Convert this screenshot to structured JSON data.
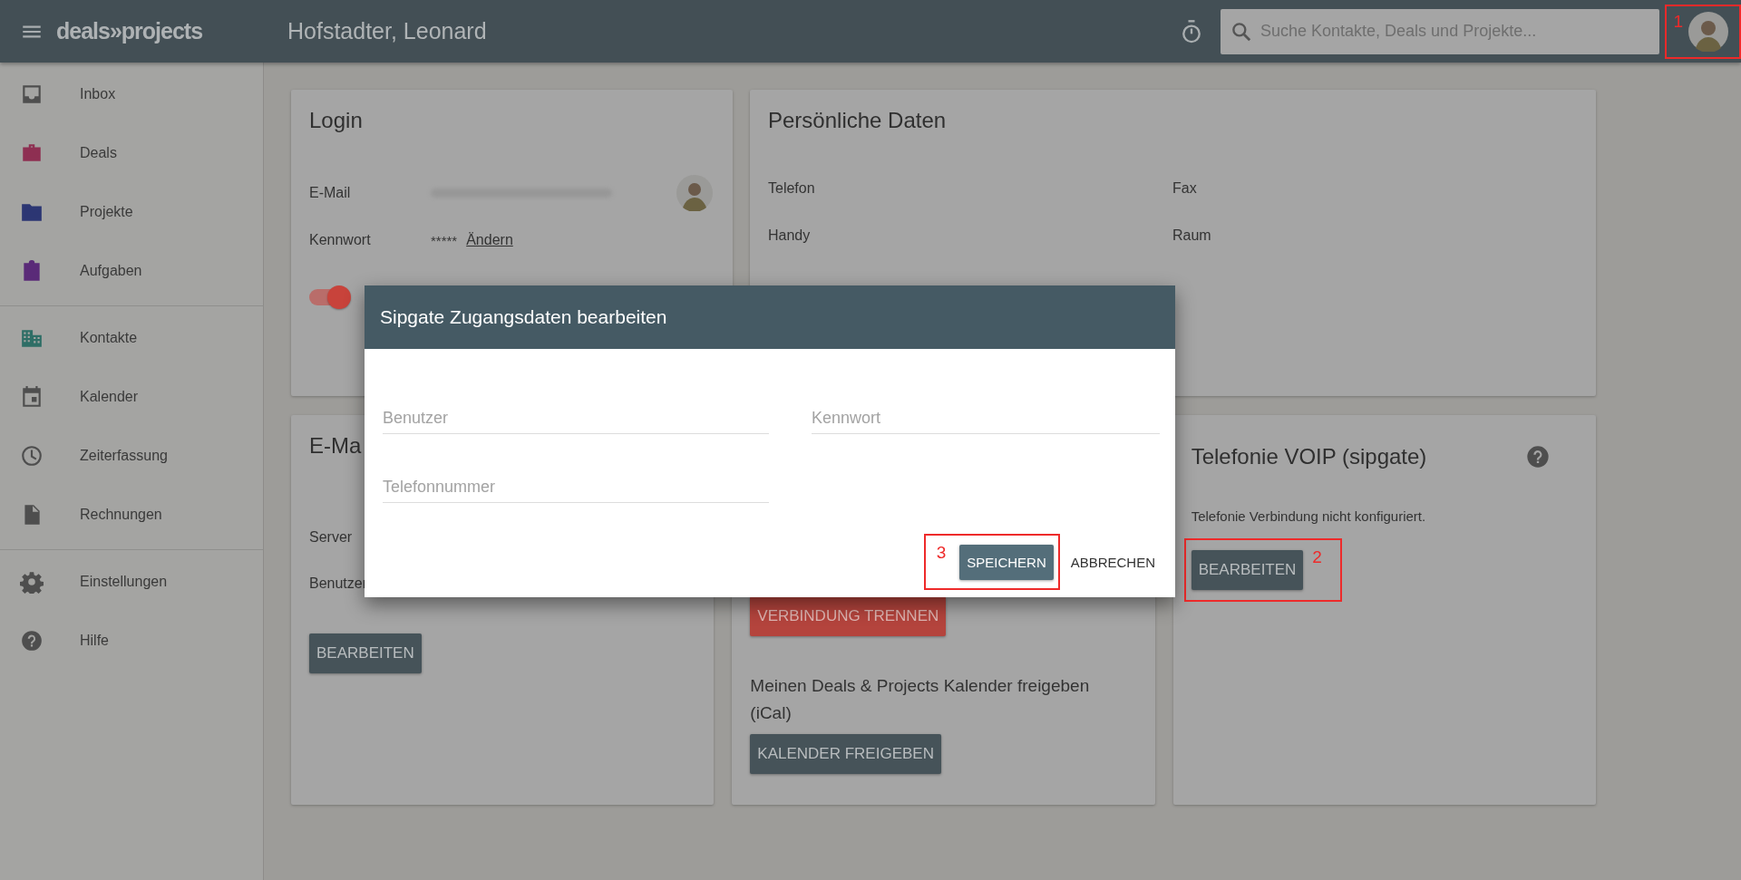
{
  "topbar": {
    "logo": "deals»projects",
    "user_name": "Hofstadter, Leonard",
    "search": {
      "placeholder": "Suche Kontakte, Deals und Projekte..."
    },
    "avatar_marker": "1"
  },
  "sidebar": {
    "groups": [
      {
        "items": [
          {
            "label": "Inbox",
            "kind": "inbox",
            "color": "#4e4e4e"
          },
          {
            "label": "Deals",
            "kind": "briefcase",
            "color": "#8e2f52"
          },
          {
            "label": "Projekte",
            "kind": "folder",
            "color": "#2c3673"
          },
          {
            "label": "Aufgaben",
            "kind": "clipboard",
            "color": "#5a2a78"
          }
        ]
      },
      {
        "items": [
          {
            "label": "Kontakte",
            "kind": "building",
            "color": "#2e6e66"
          },
          {
            "label": "Kalender",
            "kind": "calendar",
            "color": "#4e4e4e"
          },
          {
            "label": "Zeiterfassung",
            "kind": "clock",
            "color": "#4e4e4e"
          },
          {
            "label": "Rechnungen",
            "kind": "document",
            "color": "#4e4e4e"
          }
        ]
      },
      {
        "items": [
          {
            "label": "Einstellungen",
            "kind": "gear",
            "color": "#4e4e4e"
          },
          {
            "label": "Hilfe",
            "kind": "help",
            "color": "#4e4e4e"
          }
        ]
      }
    ]
  },
  "login": {
    "title": "Login",
    "email_label": "E-Mail",
    "password_label": "Kennwort",
    "password_value": "*****",
    "change_link": "Ändern",
    "toggle": {
      "on": true
    }
  },
  "personal": {
    "title": "Persönliche Daten",
    "fields": [
      {
        "label": "Telefon"
      },
      {
        "label": "Fax"
      },
      {
        "label": "Handy"
      },
      {
        "label": "Raum"
      }
    ]
  },
  "email_card": {
    "title": "E-Ma",
    "fields": [
      {
        "label": "Server"
      },
      {
        "label": "Benutzer"
      }
    ],
    "button": "BEARBEITEN"
  },
  "calendar_card": {
    "disconnect_button": "VERBINDUNG TRENNEN",
    "share_text": "Meinen Deals & Projects Kalender freigeben (iCal)",
    "share_button": "KALENDER FREIGEBEN"
  },
  "voip_card": {
    "title": "Telefonie VOIP (sipgate)",
    "status": "Telefonie Verbindung nicht konfiguriert.",
    "button": "BEARBEITEN",
    "button_marker": "2"
  },
  "dialog": {
    "title": "Sipgate Zugangsdaten bearbeiten",
    "fields": [
      {
        "placeholder": "Benutzer"
      },
      {
        "placeholder": "Kennwort"
      },
      {
        "placeholder": "Telefonnummer"
      }
    ],
    "save_button": "SPEICHERN",
    "save_marker": "3",
    "cancel_button": "ABBRECHEN"
  }
}
